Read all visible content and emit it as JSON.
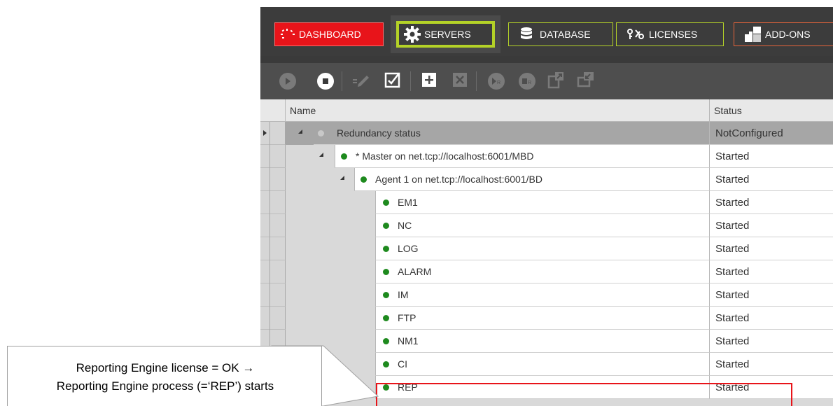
{
  "nav": {
    "dashboard": "DASHBOARD",
    "servers": "SERVERS",
    "database": "DATABASE",
    "licenses": "LICENSES",
    "addons": "ADD-ONS"
  },
  "toolbar": {
    "icons": [
      "play-icon",
      "stop-icon",
      "edit-icon",
      "checklist-icon",
      "add-icon",
      "delete-icon",
      "play-r-icon",
      "stop-r-icon",
      "export-icon",
      "import-icon"
    ]
  },
  "grid": {
    "headers": {
      "name": "Name",
      "status": "Status"
    },
    "rows": [
      {
        "name": "Redundancy status",
        "status": "NotConfigured"
      },
      {
        "name": "* Master on net.tcp://localhost:6001/MBD",
        "status": "Started"
      },
      {
        "name": "Agent 1 on net.tcp://localhost:6001/BD",
        "status": "Started"
      },
      {
        "name": "EM1",
        "status": "Started"
      },
      {
        "name": "NC",
        "status": "Started"
      },
      {
        "name": "LOG",
        "status": "Started"
      },
      {
        "name": "ALARM",
        "status": "Started"
      },
      {
        "name": "IM",
        "status": "Started"
      },
      {
        "name": "FTP",
        "status": "Started"
      },
      {
        "name": "NM1",
        "status": "Started"
      },
      {
        "name": "CI",
        "status": "Started"
      },
      {
        "name": "REP",
        "status": "Started"
      }
    ]
  },
  "callout": {
    "line1": "Reporting Engine license = OK →",
    "line2": "Reporting Engine process (=‘REP’) starts"
  },
  "colors": {
    "dashboard_red": "#e8141a",
    "servers_green": "#b4d227",
    "addons_orange": "#e8643a",
    "status_dot_green": "#1e8a1e",
    "highlight_red": "#e8141a"
  }
}
